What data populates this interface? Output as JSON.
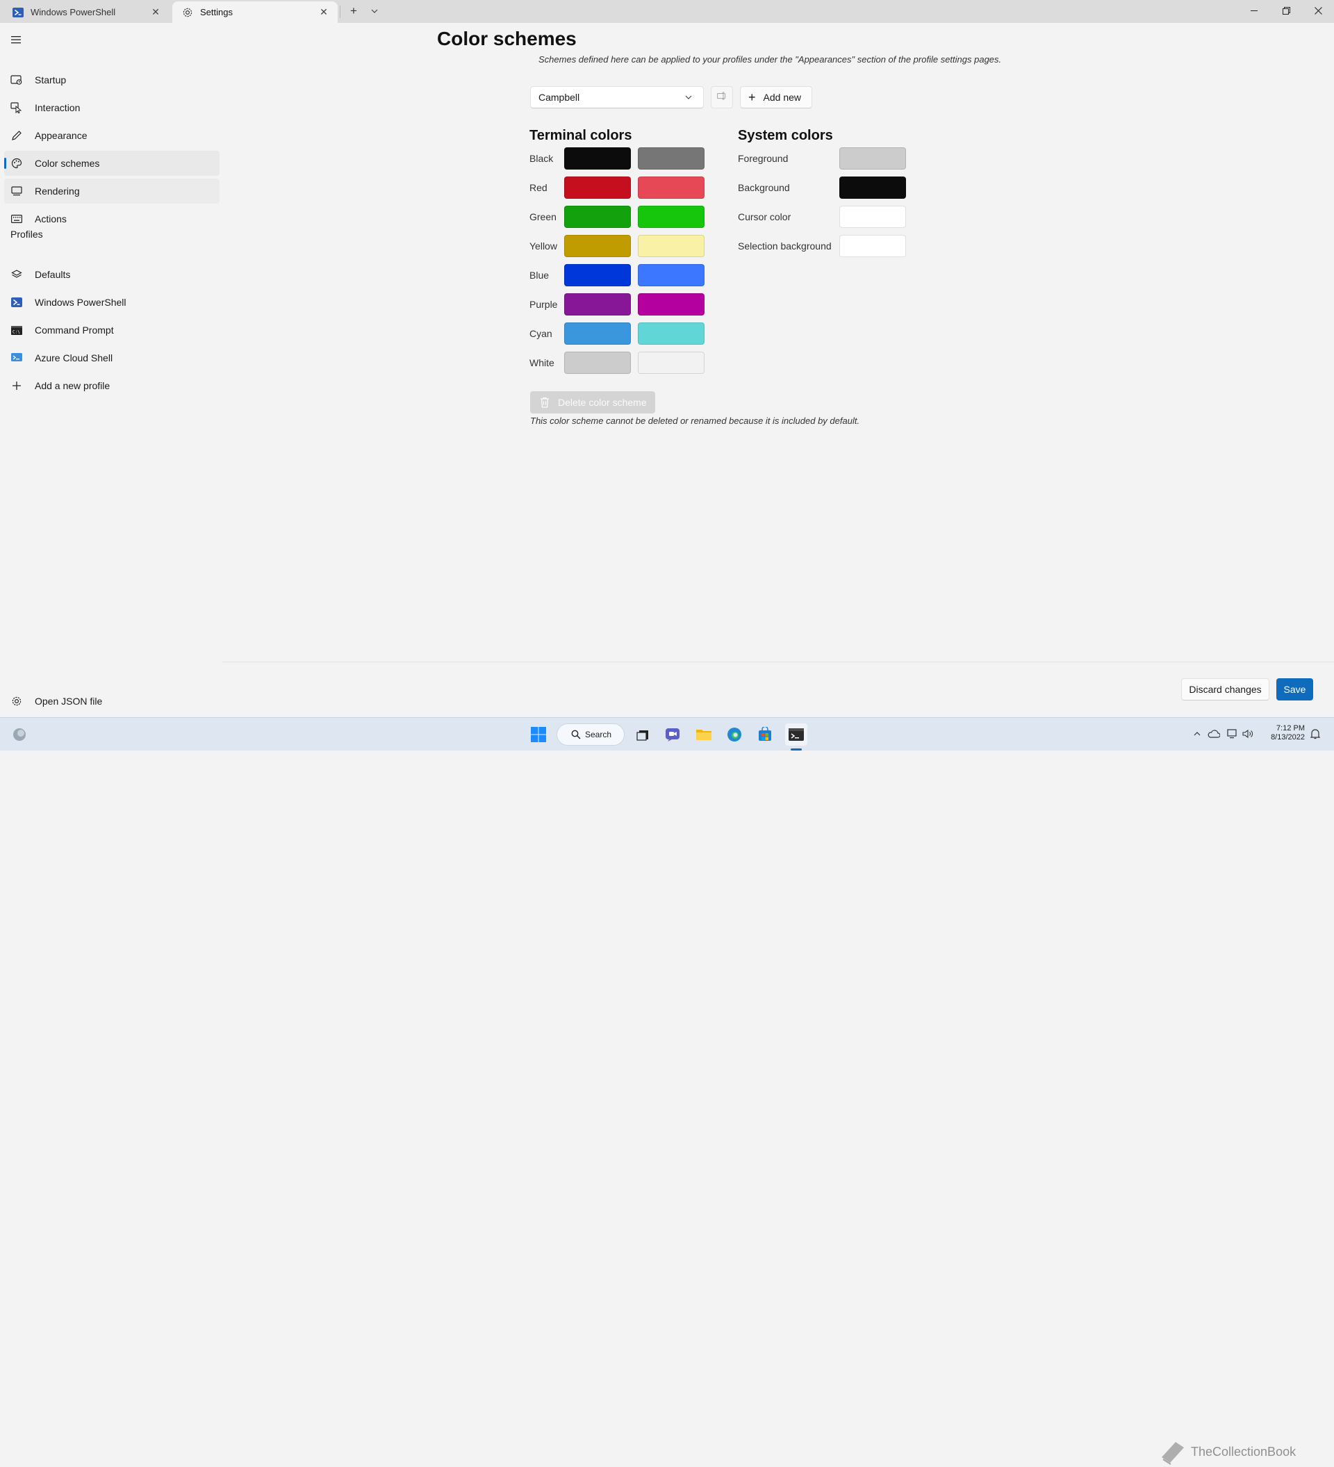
{
  "tabs": [
    {
      "label": "Windows PowerShell",
      "icon": "powershell-icon"
    },
    {
      "label": "Settings",
      "icon": "gear-icon"
    }
  ],
  "new_tab_glyph": "+",
  "tab_close_glyph": "✕",
  "sidebar": {
    "items": [
      {
        "label": "Startup",
        "icon": "startup-icon"
      },
      {
        "label": "Interaction",
        "icon": "interaction-icon"
      },
      {
        "label": "Appearance",
        "icon": "pen-icon"
      },
      {
        "label": "Color schemes",
        "icon": "palette-icon",
        "selected": true
      },
      {
        "label": "Rendering",
        "icon": "monitor-icon"
      },
      {
        "label": "Actions",
        "icon": "keyboard-icon"
      }
    ],
    "profiles_header": "Profiles",
    "profiles": [
      {
        "label": "Defaults",
        "icon": "layers-icon"
      },
      {
        "label": "Windows PowerShell",
        "icon": "powershell-icon"
      },
      {
        "label": "Command Prompt",
        "icon": "cmd-icon"
      },
      {
        "label": "Azure Cloud Shell",
        "icon": "azure-icon"
      },
      {
        "label": "Add a new profile",
        "icon": "plus-icon"
      }
    ],
    "open_json": {
      "label": "Open JSON file",
      "icon": "gear-icon"
    }
  },
  "main": {
    "title": "Color schemes",
    "description": "Schemes defined here can be applied to your profiles under the \"Appearances\" section of the profile settings pages.",
    "scheme_select_value": "Campbell",
    "add_new_label": "Add new",
    "add_new_glyph": "+",
    "terminal_colors_title": "Terminal colors",
    "terminal_colors": [
      {
        "name": "Black",
        "normal": "#0c0c0c",
        "bright": "#767676"
      },
      {
        "name": "Red",
        "normal": "#c50f1f",
        "bright": "#e74856"
      },
      {
        "name": "Green",
        "normal": "#13a10e",
        "bright": "#16c60c"
      },
      {
        "name": "Yellow",
        "normal": "#c19c00",
        "bright": "#f9f1a5"
      },
      {
        "name": "Blue",
        "normal": "#0037da",
        "bright": "#3b78ff"
      },
      {
        "name": "Purple",
        "normal": "#881798",
        "bright": "#b4009e"
      },
      {
        "name": "Cyan",
        "normal": "#3a96dd",
        "bright": "#61d6d6"
      },
      {
        "name": "White",
        "normal": "#cccccc",
        "bright": "#f2f2f2"
      }
    ],
    "system_colors_title": "System colors",
    "system_colors": [
      {
        "name": "Foreground",
        "color": "#cccccc"
      },
      {
        "name": "Background",
        "color": "#0c0c0c"
      },
      {
        "name": "Cursor color",
        "color": "#ffffff"
      },
      {
        "name": "Selection background",
        "color": "#ffffff"
      }
    ],
    "delete_label": "Delete color scheme",
    "delete_note": "This color scheme cannot be deleted or renamed because it is included by default.",
    "discard_label": "Discard changes",
    "save_label": "Save"
  },
  "taskbar": {
    "search_label": "Search",
    "time": "7:12 PM",
    "date": "8/13/2022",
    "watermark": "TheCollectionBook"
  },
  "colors": {
    "accent": "#0f6cbd",
    "taskbar": "#dde6f1"
  }
}
